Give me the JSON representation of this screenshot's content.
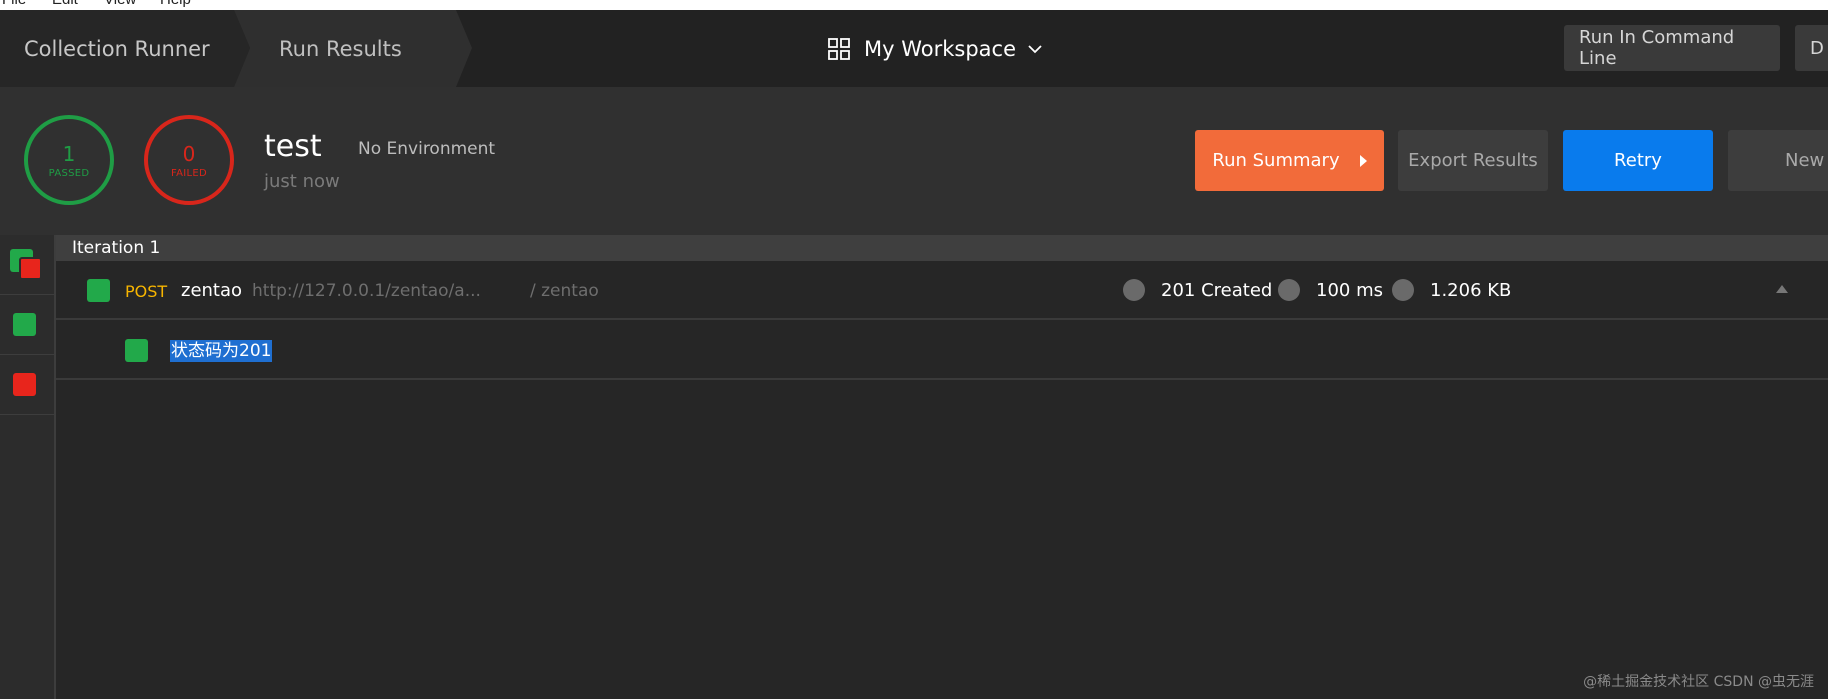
{
  "menubar": {
    "items": [
      "File",
      "Edit",
      "View",
      "Help"
    ]
  },
  "header": {
    "breadcrumb": [
      "Collection Runner",
      "Run Results"
    ],
    "workspace": "My Workspace",
    "run_cli_label": "Run In Command Line",
    "cut_button_label": "D"
  },
  "summary": {
    "passed_count": "1",
    "passed_label": "PASSED",
    "failed_count": "0",
    "failed_label": "FAILED",
    "run_name": "test",
    "environment": "No Environment",
    "time": "just now",
    "buttons": {
      "run_summary": "Run Summary",
      "export": "Export Results",
      "retry": "Retry",
      "new": "New"
    }
  },
  "results": {
    "iteration_label": "Iteration 1",
    "request": {
      "method": "POST",
      "name": "zentao",
      "url": "http://127.0.0.1/zentao/a...",
      "collection_path": "/ zentao",
      "status": "201 Created",
      "time": "100 ms",
      "size": "1.206 KB"
    },
    "tests": [
      {
        "name": "状态码为201",
        "status": "pass"
      }
    ]
  },
  "colors": {
    "pass": "#22a94a",
    "fail": "#e8251c",
    "accent_orange": "#f26b3a",
    "accent_blue": "#097bed",
    "method_post": "#f7b500"
  },
  "watermark": "@稀土掘金技术社区 CSDN @虫无涯"
}
